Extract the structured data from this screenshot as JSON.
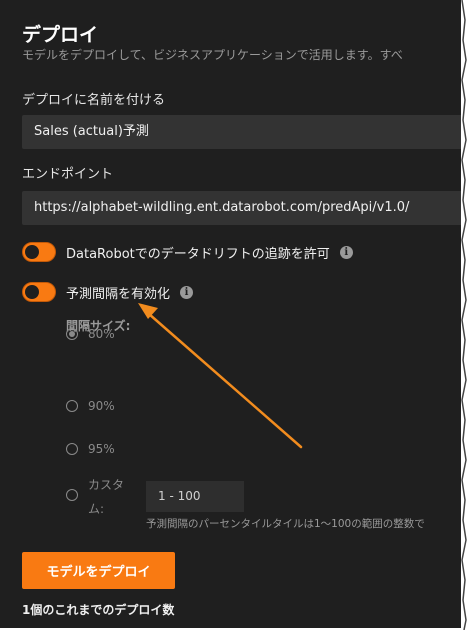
{
  "page": {
    "title": "デプロイ",
    "subtitle": "モデルをデプロイして、ビジネスアプリケーションで活用します。すべ"
  },
  "name_field": {
    "label": "デプロイに名前を付ける",
    "value": "Sales (actual)予測"
  },
  "endpoint_field": {
    "label": "エンドポイント",
    "value": "https://alphabet-wildling.ent.datarobot.com/predApi/v1.0/"
  },
  "toggles": [
    {
      "label": "DataRobotでのデータドリフトの追跡を許可",
      "on": true,
      "icon": "info-icon"
    },
    {
      "label": "予測間隔を有効化",
      "on": true,
      "icon": "info-icon"
    }
  ],
  "interval": {
    "title": "間隔サイズ:",
    "options": [
      {
        "label": "80%",
        "selected": true
      },
      {
        "label": "90%",
        "selected": false
      },
      {
        "label": "95%",
        "selected": false
      }
    ],
    "custom_label": "カスタム:",
    "custom_value": "1 - 100",
    "hint": "予測間隔のパーセンタイルタイルは1〜100の範囲の整数で"
  },
  "deploy_button": {
    "label": "モデルをデプロイ"
  },
  "deploy_count": "1個のこれまでのデプロイ数",
  "colors": {
    "accent": "#f97a12",
    "background": "#1f1f1f",
    "annotation_arrow": "#f28c1e"
  }
}
